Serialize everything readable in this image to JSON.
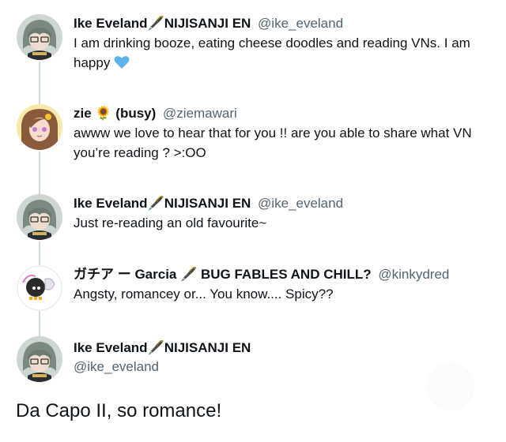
{
  "thread": [
    {
      "name": "Ike Eveland🖋️NIJISANJI EN",
      "handle": "@ike_eveland",
      "text": "I am drinking booze, eating cheese doodles and reading VNs. I am happy",
      "emoji": "blue-heart-icon"
    },
    {
      "name": "zie 🌻 (busy)",
      "handle": "@ziemawari",
      "text": "awww we love to hear that for you !! are you able to share what VN you’re reading ? >:OO"
    },
    {
      "name": "Ike Eveland🖋️NIJISANJI EN",
      "handle": "@ike_eveland",
      "text": "Just re-reading an old favourite~"
    },
    {
      "name": "ガチア ー Garcia 🖋️ BUG FABLES AND CHILL?",
      "handle": "@kinkydred",
      "text": "Angsty, romancey or... You know.... Spicy??"
    }
  ],
  "main_tweet": {
    "name": "Ike Eveland🖋️NIJISANJI EN",
    "handle": "@ike_eveland",
    "text": "Da Capo II, so romance!"
  },
  "colors": {
    "text": "#0f1419",
    "handle": "#536471",
    "thread_line": "#cfd9de",
    "heart": "#5eb2ee"
  }
}
